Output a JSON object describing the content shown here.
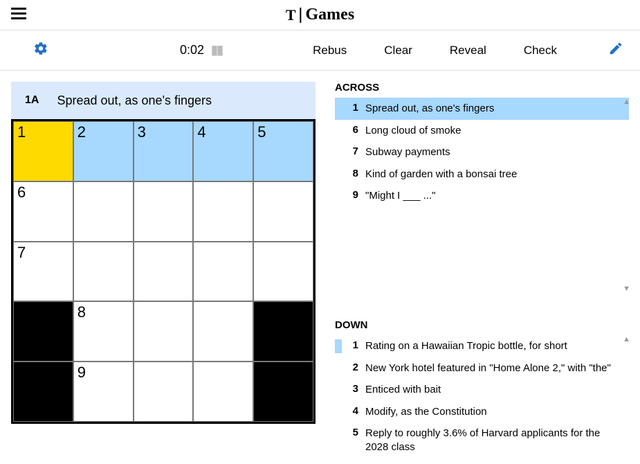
{
  "brand": {
    "nyt": "T",
    "games": "Games"
  },
  "toolbar": {
    "timer": "0:02",
    "rebus": "Rebus",
    "clear": "Clear",
    "reveal": "Reveal",
    "check": "Check"
  },
  "active_clue": {
    "label": "1A",
    "text": "Spread out, as one's fingers"
  },
  "grid": {
    "size": 5,
    "cells": [
      {
        "r": 0,
        "c": 0,
        "num": "1",
        "state": "focus"
      },
      {
        "r": 0,
        "c": 1,
        "num": "2",
        "state": "active-row"
      },
      {
        "r": 0,
        "c": 2,
        "num": "3",
        "state": "active-row"
      },
      {
        "r": 0,
        "c": 3,
        "num": "4",
        "state": "active-row"
      },
      {
        "r": 0,
        "c": 4,
        "num": "5",
        "state": "active-row"
      },
      {
        "r": 1,
        "c": 0,
        "num": "6",
        "state": ""
      },
      {
        "r": 1,
        "c": 1,
        "state": ""
      },
      {
        "r": 1,
        "c": 2,
        "state": ""
      },
      {
        "r": 1,
        "c": 3,
        "state": ""
      },
      {
        "r": 1,
        "c": 4,
        "state": ""
      },
      {
        "r": 2,
        "c": 0,
        "num": "7",
        "state": ""
      },
      {
        "r": 2,
        "c": 1,
        "state": ""
      },
      {
        "r": 2,
        "c": 2,
        "state": ""
      },
      {
        "r": 2,
        "c": 3,
        "state": ""
      },
      {
        "r": 2,
        "c": 4,
        "state": ""
      },
      {
        "r": 3,
        "c": 0,
        "state": "black"
      },
      {
        "r": 3,
        "c": 1,
        "num": "8",
        "state": ""
      },
      {
        "r": 3,
        "c": 2,
        "state": ""
      },
      {
        "r": 3,
        "c": 3,
        "state": ""
      },
      {
        "r": 3,
        "c": 4,
        "state": "black"
      },
      {
        "r": 4,
        "c": 0,
        "state": "black"
      },
      {
        "r": 4,
        "c": 1,
        "num": "9",
        "state": ""
      },
      {
        "r": 4,
        "c": 2,
        "state": ""
      },
      {
        "r": 4,
        "c": 3,
        "state": ""
      },
      {
        "r": 4,
        "c": 4,
        "state": "black"
      }
    ]
  },
  "across": {
    "header": "ACROSS",
    "clues": [
      {
        "num": "1",
        "text": "Spread out, as one's fingers",
        "selected": true
      },
      {
        "num": "6",
        "text": "Long cloud of smoke"
      },
      {
        "num": "7",
        "text": "Subway payments"
      },
      {
        "num": "8",
        "text": "Kind of garden with a bonsai tree"
      },
      {
        "num": "9",
        "text": "\"Might I ___ ...\""
      }
    ]
  },
  "down": {
    "header": "DOWN",
    "clues": [
      {
        "num": "1",
        "text": "Rating on a Hawaiian Tropic bottle, for short",
        "related": true
      },
      {
        "num": "2",
        "text": "New York hotel featured in \"Home Alone 2,\" with \"the\""
      },
      {
        "num": "3",
        "text": "Enticed with bait"
      },
      {
        "num": "4",
        "text": "Modify, as the Constitution"
      },
      {
        "num": "5",
        "text": "Reply to roughly 3.6% of Harvard applicants for the 2028 class"
      }
    ]
  }
}
